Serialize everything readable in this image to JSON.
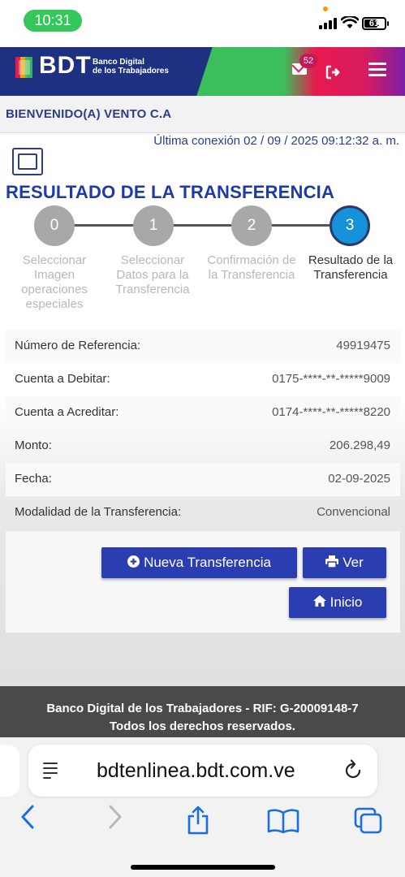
{
  "status_bar": {
    "time": "10:31",
    "battery": "61"
  },
  "header": {
    "logo_text": "BDT",
    "logo_subtitle_line1": "Banco Digital",
    "logo_subtitle_line2": "de los Trabajadores",
    "notification_count": "52"
  },
  "welcome": "BIENVENIDO(A) VENTO C.A",
  "last_connection": "Última conexión 02 / 09 / 2025 09:12:32 a. m.",
  "page_title": "RESULTADO DE LA TRANSFERENCIA",
  "steps": [
    {
      "number": "0",
      "label": "Seleccionar Imagen operaciones especiales"
    },
    {
      "number": "1",
      "label": "Seleccionar Datos para la Transferencia"
    },
    {
      "number": "2",
      "label": "Confirmación de la Transferencia"
    },
    {
      "number": "3",
      "label": "Resultado de la Transferencia"
    }
  ],
  "active_step": 3,
  "details": [
    {
      "label": "Número de Referencia:",
      "value": "49919475"
    },
    {
      "label": "Cuenta a Debitar:",
      "value": "0175-****-**-*****9009"
    },
    {
      "label": "Cuenta a Acreditar:",
      "value": "0174-****-**-*****8220"
    },
    {
      "label": "Monto:",
      "value": "206.298,49"
    },
    {
      "label": "Fecha:",
      "value": "02-09-2025"
    },
    {
      "label": "Modalidad de la Transferencia:",
      "value": "Convencional"
    }
  ],
  "buttons": {
    "new_transfer": "Nueva Transferencia",
    "view": "Ver",
    "home": "Inicio"
  },
  "footer": {
    "line1": "Banco Digital de los Trabajadores - RIF: G-20009148-7",
    "line2": "Todos los derechos reservados."
  },
  "browser": {
    "url": "bdtenlinea.bdt.com.ve"
  },
  "colors": {
    "brand_blue": "#1e3181",
    "button_blue": "#2a3eb1",
    "step_active": "#1592d9",
    "status_green": "#34c759"
  }
}
